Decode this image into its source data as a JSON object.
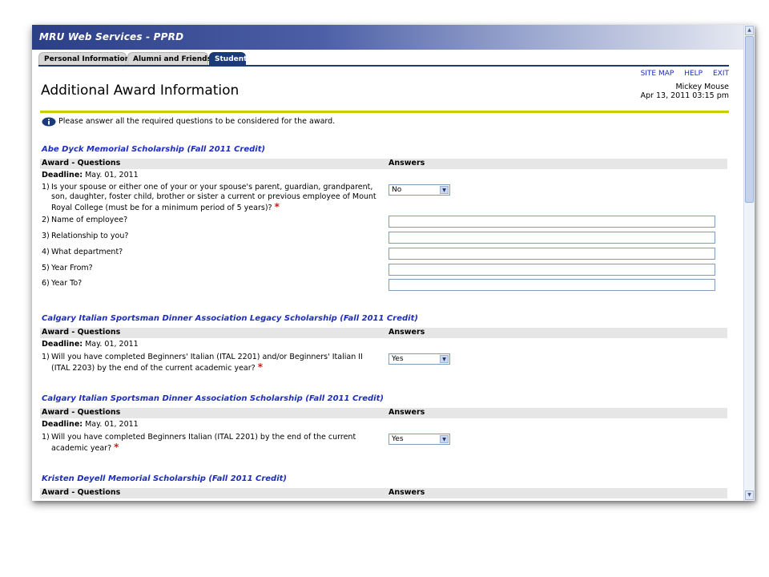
{
  "app": {
    "title": "MRU Web Services - PPRD"
  },
  "tabs": [
    {
      "label": "Personal Information"
    },
    {
      "label": "Alumni and Friends"
    },
    {
      "label": "Student"
    }
  ],
  "toplinks": {
    "site_map": "SITE MAP",
    "help": "HELP",
    "exit": "EXIT"
  },
  "user": {
    "name": "Mickey Mouse",
    "datetime": "Apr 13, 2011 03:15 pm"
  },
  "page": {
    "title": "Additional Award Information",
    "info": "Please answer all the required questions to be considered for the award."
  },
  "table_headers": {
    "questions": "Award - Questions",
    "answers": "Answers"
  },
  "deadline_label": "Deadline:",
  "awards": [
    {
      "title": "Abe Dyck Memorial Scholarship (Fall 2011 Credit)",
      "deadline": "May. 01, 2011",
      "questions": [
        {
          "num": "1)",
          "text": "Is your spouse or either one of your or your spouse's parent, guardian, grandparent, son, daughter, foster child, brother or sister a current or previous employee of Mount Royal College (must be for a minimum period of 5 years)?",
          "required": "*",
          "answer": "No"
        },
        {
          "num": "2)",
          "text": "Name of employee?",
          "answer": ""
        },
        {
          "num": "3)",
          "text": "Relationship to you?",
          "answer": ""
        },
        {
          "num": "4)",
          "text": "What department?",
          "answer": ""
        },
        {
          "num": "5)",
          "text": "Year From?",
          "answer": ""
        },
        {
          "num": "6)",
          "text": "Year To?",
          "answer": ""
        }
      ]
    },
    {
      "title": "Calgary Italian Sportsman Dinner Association Legacy Scholarship (Fall 2011 Credit)",
      "deadline": "May. 01, 2011",
      "questions": [
        {
          "num": "1)",
          "text": "Will you have completed Beginners' Italian (ITAL 2201) and/or Beginners' Italian II (ITAL 2203) by the end of the current academic year?",
          "required": "*",
          "answer": "Yes"
        }
      ]
    },
    {
      "title": "Calgary Italian Sportsman Dinner Association Scholarship (Fall 2011 Credit)",
      "deadline": "May. 01, 2011",
      "questions": [
        {
          "num": "1)",
          "text": "Will you have completed Beginners Italian (ITAL 2201) by the end of the current academic year?",
          "required": "*",
          "answer": "Yes"
        }
      ]
    },
    {
      "title": "Kristen Deyell Memorial Scholarship (Fall 2011 Credit)"
    }
  ],
  "icons": {
    "info": "info-icon",
    "dropdown": "chevron-down-icon",
    "scroll_up": "arrow-up-icon",
    "scroll_down": "arrow-down-icon"
  },
  "colors": {
    "banner": "#2c3f86",
    "tab_active": "#1b3a78",
    "award_title": "#1d2dbd",
    "divider": "#cccc00",
    "required": "#d21a1a",
    "link": "#1a2dbd"
  }
}
